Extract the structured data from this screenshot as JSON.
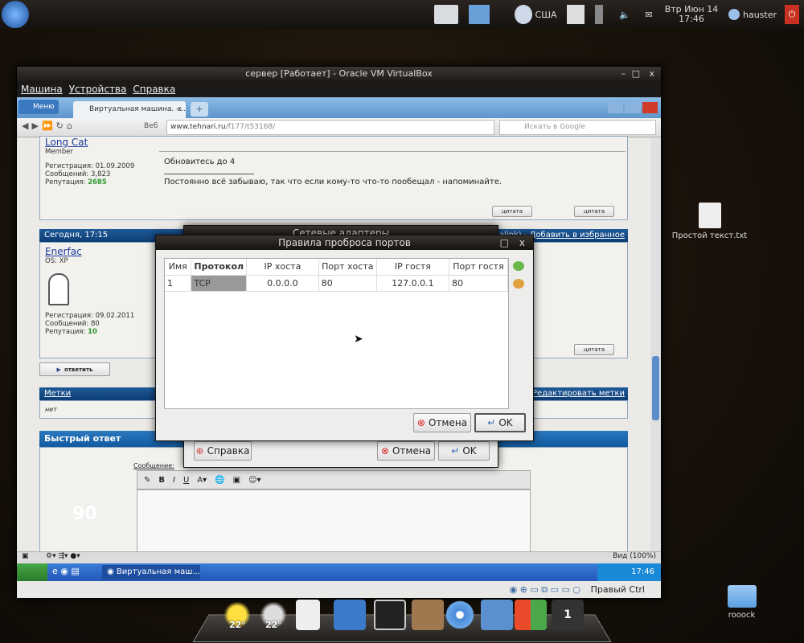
{
  "top_panel": {
    "keyboard_layout": "США",
    "date": "Втр Июн 14",
    "time": "17:46",
    "user": "hauster"
  },
  "vbox": {
    "title": "сервер [Работает] - Oracle VM VirtualBox",
    "menu": [
      "Машина",
      "Устройства",
      "Справка"
    ],
    "status_key": "Правый Ctrl"
  },
  "browser": {
    "menu_label": "Меню",
    "tab_title": "Виртуальная машина. -...",
    "url_host": "www.tehnari.ru",
    "url_path": "/f177/t53168/",
    "web_label": "Веб",
    "search_placeholder": "Искать в Google",
    "zoom": "Вид (100%)"
  },
  "post1": {
    "author": "Long Cat",
    "rank": "Member",
    "reg": "Регистрация: 01.09.2009",
    "msgs": "Сообщений: 3,823",
    "rep_label": "Репутация:",
    "rep": "2685",
    "text1": "Обновитесь до 4",
    "signature": "Постоянно всё забываю, так что если кому-то что-то пообещал - напоминайте.",
    "quote": "цитата"
  },
  "post2": {
    "date": "Сегодня, 17:15",
    "links_tail": "(permalink)",
    "favorite": "Добавить в избранное",
    "author": "Enerfac",
    "os": "OS: XP",
    "reg": "Регистрация: 09.02.2011",
    "msgs": "Сообщений: 80",
    "rep_label": "Репутация:",
    "rep": "10",
    "quote": "цитата"
  },
  "reply_button": "ответить",
  "tags": {
    "title": "Метки",
    "edit": "Редактировать метки",
    "value": "нет"
  },
  "quick_reply": {
    "title": "Быстрый ответ",
    "message_label": "Сообщение:",
    "watermark": "90"
  },
  "xp_taskbar": {
    "task": "Виртуальная маш...",
    "time": "17:46"
  },
  "back_dialog": {
    "title": "Сетевые адаптеры",
    "help": "Справка",
    "cancel": "Отмена",
    "ok": "OK"
  },
  "port_dialog": {
    "title": "Правила проброса портов",
    "columns": [
      "Имя",
      "Протокол",
      "IP хоста",
      "Порт хоста",
      "IP гостя",
      "Порт гостя"
    ],
    "rows": [
      [
        "1",
        "TCP",
        "0.0.0.0",
        "80",
        "127.0.0.1",
        "80"
      ]
    ],
    "cancel": "Отмена",
    "ok": "OK"
  },
  "desktop": {
    "file": "Простой текст.txt",
    "folder": "rooock"
  },
  "dock": {
    "weather1": "22°",
    "weather2": "22°",
    "workspace": "1"
  }
}
